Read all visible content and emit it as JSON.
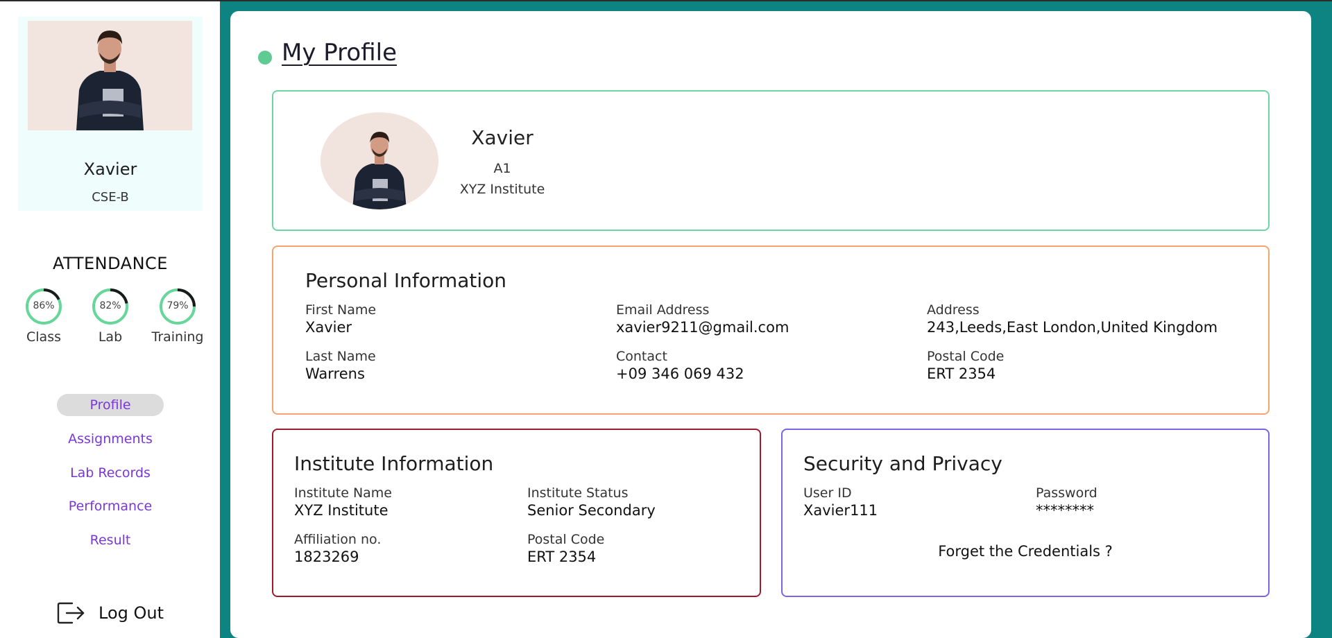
{
  "sidebar": {
    "name": "Xavier",
    "section": "CSE-B",
    "attendance_title": "ATTENDANCE",
    "attendance": [
      {
        "label": "Class",
        "percent_text": "86%",
        "value": 0.86
      },
      {
        "label": "Lab",
        "percent_text": "82%",
        "value": 0.82
      },
      {
        "label": "Training",
        "percent_text": "79%",
        "value": 0.79
      }
    ],
    "nav": [
      "Profile",
      "Assignments",
      "Lab Records",
      "Performance",
      "Result"
    ],
    "active_nav": "Profile",
    "logout_label": "Log Out"
  },
  "main": {
    "title": "My Profile",
    "header": {
      "name": "Xavier",
      "section": "A1",
      "institute": "XYZ Institute"
    },
    "personal": {
      "title": "Personal Information",
      "first_name_label": "First Name",
      "first_name": "Xavier",
      "last_name_label": "Last Name",
      "last_name": "Warrens",
      "email_label": "Email Address",
      "email": "xavier9211@gmail.com",
      "contact_label": "Contact",
      "contact": "+09 346 069 432",
      "address_label": "Address",
      "address": "243,Leeds,East London,United Kingdom",
      "postal_label": "Postal Code",
      "postal": "ERT 2354"
    },
    "institute": {
      "title": "Institute Information",
      "name_label": "Institute Name",
      "name": "XYZ Institute",
      "status_label": "Institute Status",
      "status": "Senior Secondary",
      "affiliation_label": "Affiliation no.",
      "affiliation": "1823269",
      "postal_label": "Postal Code",
      "postal": "ERT 2354"
    },
    "security": {
      "title": "Security and Privacy",
      "userid_label": "User ID",
      "userid": "Xavier111",
      "password_label": "Password",
      "password": "********",
      "forget_label": "Forget the Credentials ?"
    }
  },
  "colors": {
    "teal": "#0e8482",
    "accent_green": "#5ecb93",
    "nav_purple": "#7a37d8",
    "personal_border": "#f5a46d",
    "institute_border": "#9b1b2d",
    "security_border": "#7b63e3"
  },
  "icons": {
    "logout": "logout-arrow-icon",
    "title_marker": "green-dot-icon"
  }
}
